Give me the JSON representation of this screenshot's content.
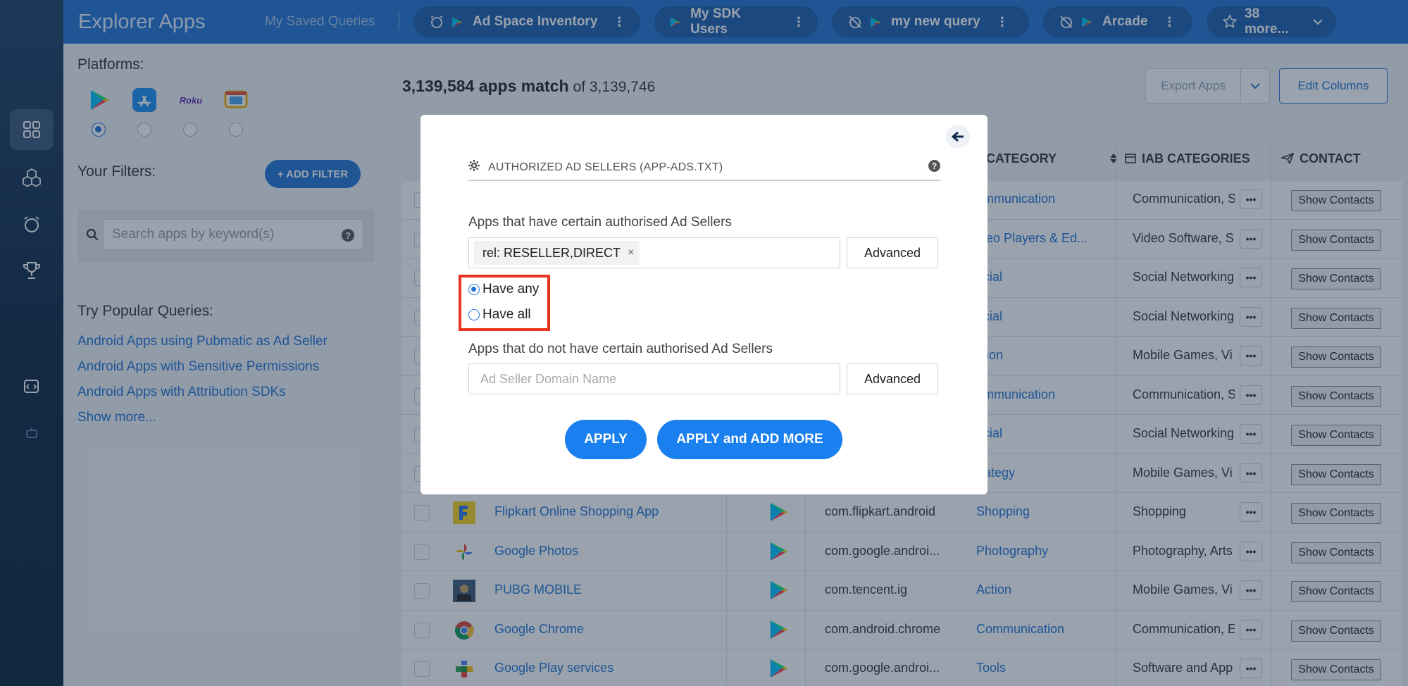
{
  "topbar": {
    "brand": "Explorer Apps",
    "saved_label": "My Saved Queries",
    "tabs": [
      {
        "label": "Ad Space Inventory",
        "icon": "alarm-icon"
      },
      {
        "label": "My SDK Users",
        "icon": "none"
      },
      {
        "label": "my new query",
        "icon": "alarm-off-icon"
      },
      {
        "label": "Arcade",
        "icon": "alarm-off-icon"
      }
    ],
    "more_label": "38 more..."
  },
  "filters": {
    "platforms_label": "Platforms:",
    "platforms": [
      "google-play-icon",
      "app-store-icon",
      "roku-icon",
      "tv-icon"
    ],
    "roku_text": "Roku",
    "selected_platform": 0,
    "your_filters_label": "Your Filters:",
    "add_filter_label": "+ ADD FILTER",
    "search_placeholder": "Search apps by keyword(s)",
    "popular_label": "Try Popular Queries:",
    "popular_queries": [
      "Android Apps using Pubmatic as Ad Seller",
      "Android Apps with Sensitive Permissions",
      "Android Apps with Attribution SDKs",
      "Show more..."
    ]
  },
  "results": {
    "count": "3,139,584 apps match",
    "of_total": "of 3,139,746",
    "export_label": "Export Apps",
    "edit_columns_label": "Edit Columns"
  },
  "table": {
    "headers": {
      "category": "CATEGORY",
      "iab": "IAB CATEGORIES",
      "contact": "CONTACT"
    },
    "show_contacts_label": "Show Contacts",
    "more_label": "•••",
    "rows": [
      {
        "name": "",
        "pkg": "",
        "cat": "ommunication",
        "iab": "Communication, S"
      },
      {
        "name": "",
        "pkg": "",
        "cat": "ideo Players & Ed...",
        "iab": "Video Software, S"
      },
      {
        "name": "",
        "pkg": "",
        "cat": "ocial",
        "iab": "Social Networking"
      },
      {
        "name": "",
        "pkg": "",
        "cat": "ocial",
        "iab": "Social Networking"
      },
      {
        "name": "",
        "pkg": "",
        "cat": "ction",
        "iab": "Mobile Games, Vi"
      },
      {
        "name": "",
        "pkg": "",
        "cat": "ommunication",
        "iab": "Communication, S"
      },
      {
        "name": "",
        "pkg": "",
        "cat": "ocial",
        "iab": "Social Networking"
      },
      {
        "name": "",
        "pkg": "",
        "cat": "trategy",
        "iab": "Mobile Games, Vi"
      },
      {
        "name": "Flipkart Online Shopping App",
        "pkg": "com.flipkart.android",
        "cat": "Shopping",
        "iab": "Shopping"
      },
      {
        "name": "Google Photos",
        "pkg": "com.google.androi...",
        "cat": "Photography",
        "iab": "Photography, Arts"
      },
      {
        "name": "PUBG MOBILE",
        "pkg": "com.tencent.ig",
        "cat": "Action",
        "iab": "Mobile Games, Vi"
      },
      {
        "name": "Google Chrome",
        "pkg": "com.android.chrome",
        "cat": "Communication",
        "iab": "Communication, E"
      },
      {
        "name": "Google Play services",
        "pkg": "com.google.androi...",
        "cat": "Tools",
        "iab": "Software and App"
      }
    ]
  },
  "modal": {
    "title": "AUTHORIZED AD SELLERS (APP-ADS.TXT)",
    "help": "?",
    "have_label": "Apps that have certain authorised Ad Sellers",
    "have_tag": "rel: RESELLER,DIRECT",
    "tag_remove": "×",
    "advanced_label": "Advanced",
    "radio_any": "Have any",
    "radio_all": "Have all",
    "selected_radio": "any",
    "not_have_label": "Apps that do not have certain authorised Ad Sellers",
    "not_have_placeholder": "Ad Seller Domain Name",
    "apply_label": "APPLY",
    "apply_more_label": "APPLY and ADD MORE"
  },
  "colors": {
    "brand_blue": "#2173d3",
    "button_blue": "#1a7fef",
    "highlight_red": "#e9331c",
    "rail_dark": "#0c2441"
  }
}
